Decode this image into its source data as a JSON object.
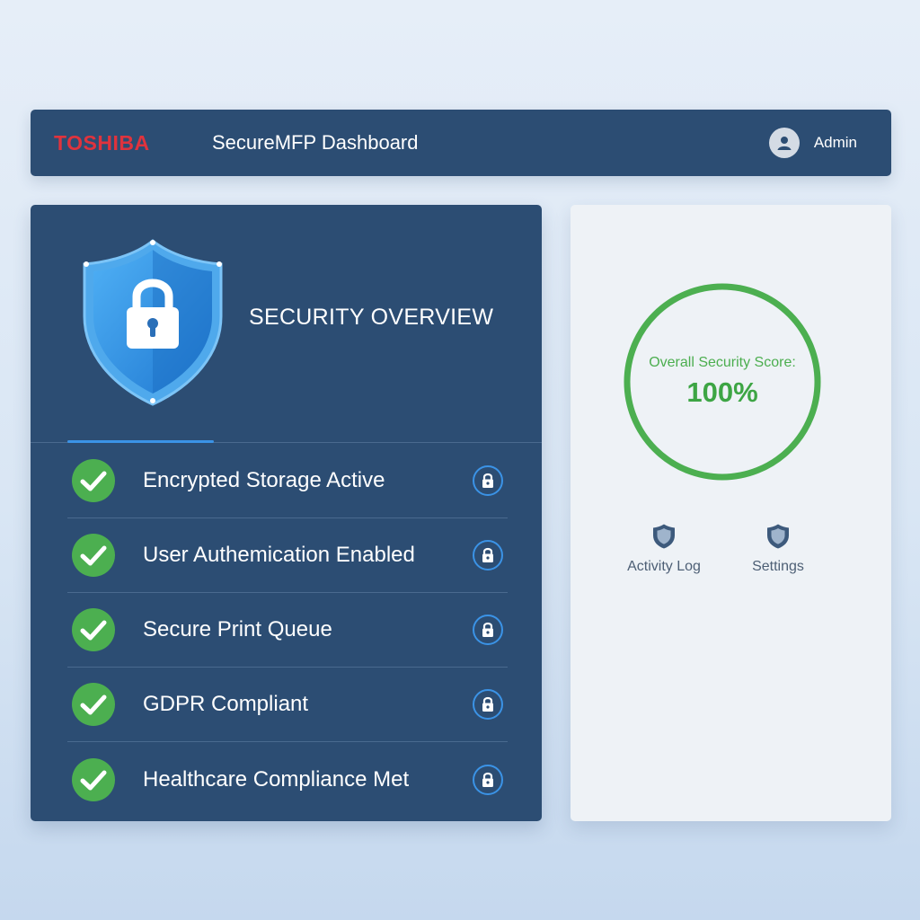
{
  "header": {
    "brand": "TOSHIBA",
    "title": "SecureMFP Dashboard",
    "user": "Admin"
  },
  "overview": {
    "title": "SECURITY OVERVIEW",
    "items": [
      {
        "label": "Encrypted Storage Active",
        "status": "checked",
        "icon": "lock-icon"
      },
      {
        "label": "User Authemication Enabled",
        "status": "checked",
        "icon": "lock-icon"
      },
      {
        "label": "Secure Print Queue",
        "status": "checked",
        "icon": "lock-icon"
      },
      {
        "label": "GDPR Compliant",
        "status": "checked",
        "icon": "lock-icon"
      },
      {
        "label": "Healthcare Compliance Met",
        "status": "checked",
        "icon": "lock-icon"
      }
    ]
  },
  "score": {
    "label": "Overall Security Score:",
    "value": "100%",
    "fraction": 1.0
  },
  "actions": {
    "activity_log": "Activity Log",
    "settings": "Settings"
  },
  "colors": {
    "panel": "#2c4d73",
    "brand": "#e0333d",
    "success": "#4caf50",
    "accent": "#3b93e6"
  }
}
